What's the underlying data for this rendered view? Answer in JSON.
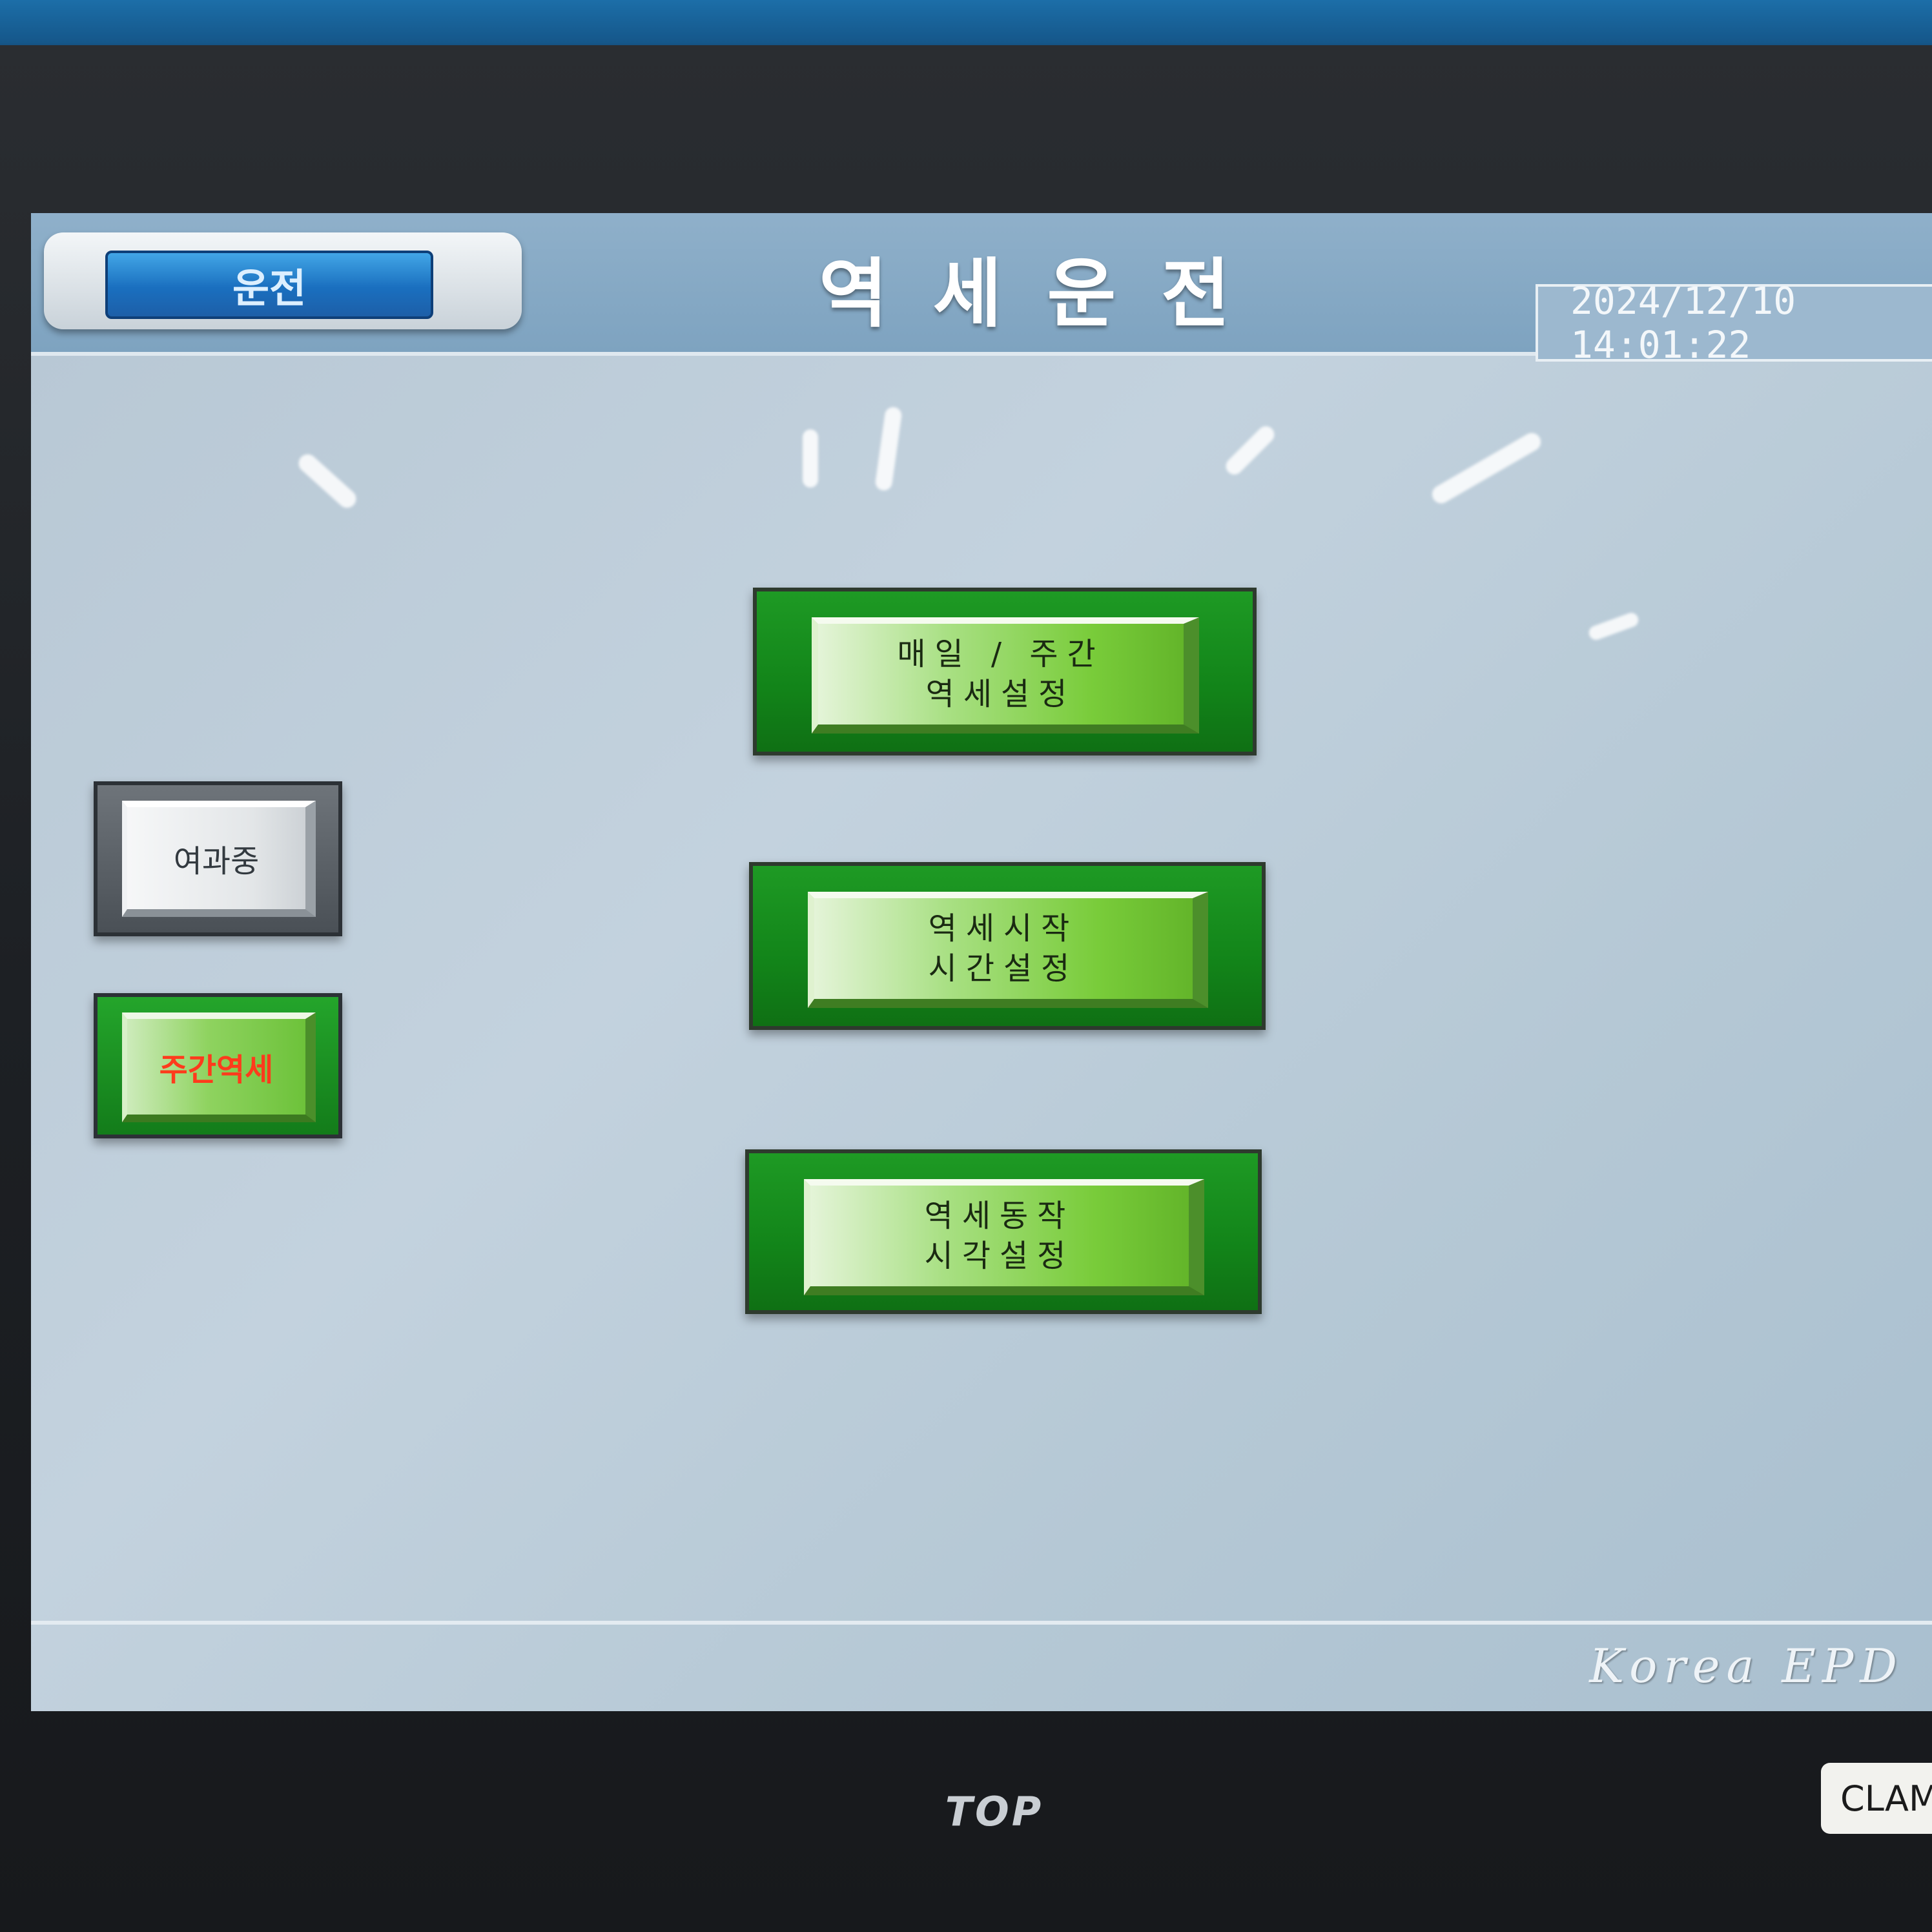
{
  "header": {
    "mode_label": "운전",
    "title": "역세운전",
    "datetime": "2024/12/10 14:01:22"
  },
  "buttons": {
    "daily_weekly": {
      "line1": "매일 / 주간",
      "line2": "역세설정"
    },
    "start_time": {
      "line1": "역세시작",
      "line2": "시간설정"
    },
    "action_time": {
      "line1": "역세동작",
      "line2": "시각설정"
    },
    "filtering": "여과중",
    "weekly_backwash": "주간역세"
  },
  "footer": {
    "brand": "Korea EPD"
  },
  "device": {
    "bezel_logo": "TOP",
    "side_label": "CLAMI"
  },
  "colors": {
    "button_green": "#128419",
    "warning_red": "#ff3b1c",
    "mode_blue": "#1a6fbf"
  }
}
